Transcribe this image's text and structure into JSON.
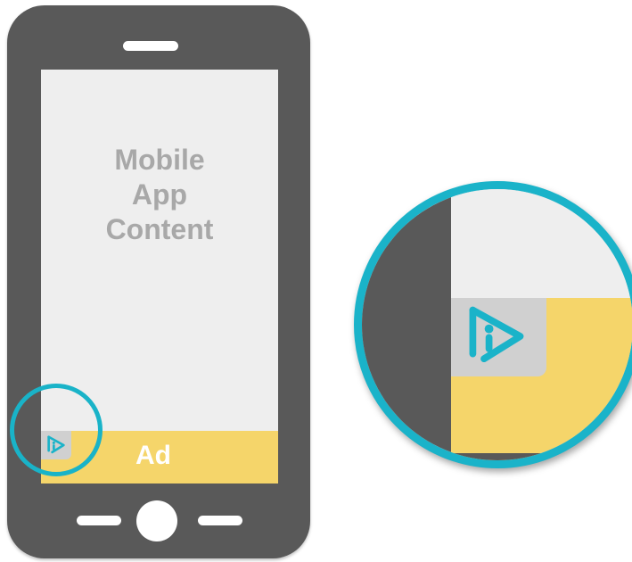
{
  "phone": {
    "content_lines": [
      "Mobile",
      "App",
      "Content"
    ],
    "ad_label": "Ad"
  },
  "colors": {
    "phone_body": "#595959",
    "screen": "#eeeeee",
    "ad_banner": "#f5d56a",
    "highlight_ring": "#19b3c8",
    "logo": "#1ab3c9",
    "badge": "#d0d0d0"
  },
  "icons": {
    "ad_choice_logo": "play-i-logo-icon"
  }
}
